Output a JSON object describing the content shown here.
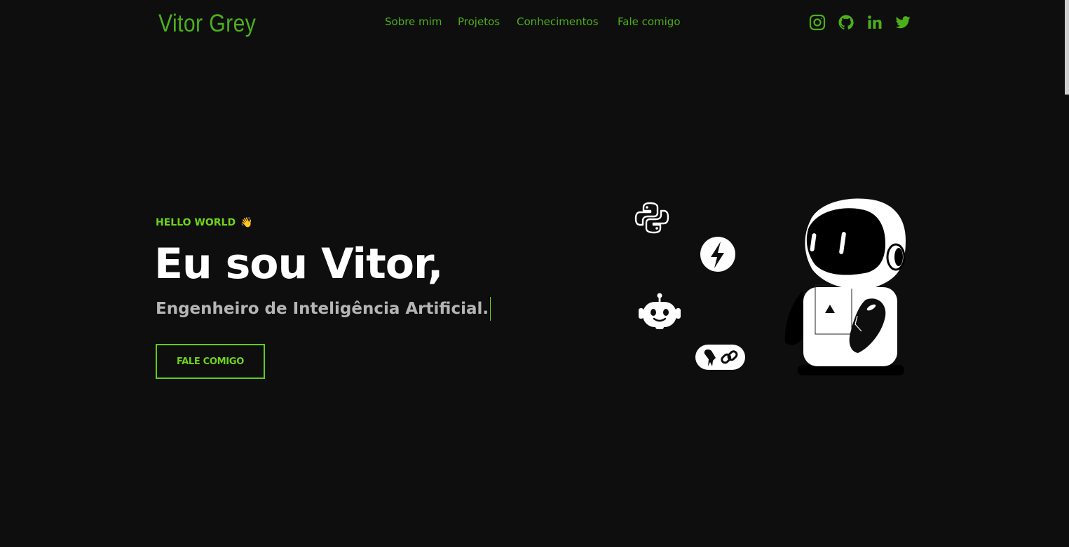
{
  "header": {
    "logo": "Vitor Grey",
    "nav": [
      {
        "label": "Sobre mim"
      },
      {
        "label": "Projetos"
      },
      {
        "label": "Conhecimentos"
      },
      {
        "label": "Fale comigo"
      }
    ],
    "social": [
      {
        "icon": "instagram-icon"
      },
      {
        "icon": "github-icon"
      },
      {
        "icon": "linkedin-icon"
      },
      {
        "icon": "twitter-icon"
      }
    ]
  },
  "hero": {
    "eyebrow": "HELLO WORLD",
    "eyebrow_emoji": "👋",
    "headline": "Eu sou Vitor,",
    "role": "Engenheiro de Inteligência Artificial.",
    "cta_label": "FALE COMIGO"
  },
  "illustration": {
    "icons": [
      "python-icon",
      "lightning-icon",
      "chatbot-icon",
      "parrot-link-icon",
      "robot-illustration"
    ]
  },
  "colors": {
    "background": "#0e0e0e",
    "accent": "#4caf1a",
    "accent_bright": "#6fd416",
    "headline": "#ffffff",
    "subtitle": "#b5b5b5"
  }
}
